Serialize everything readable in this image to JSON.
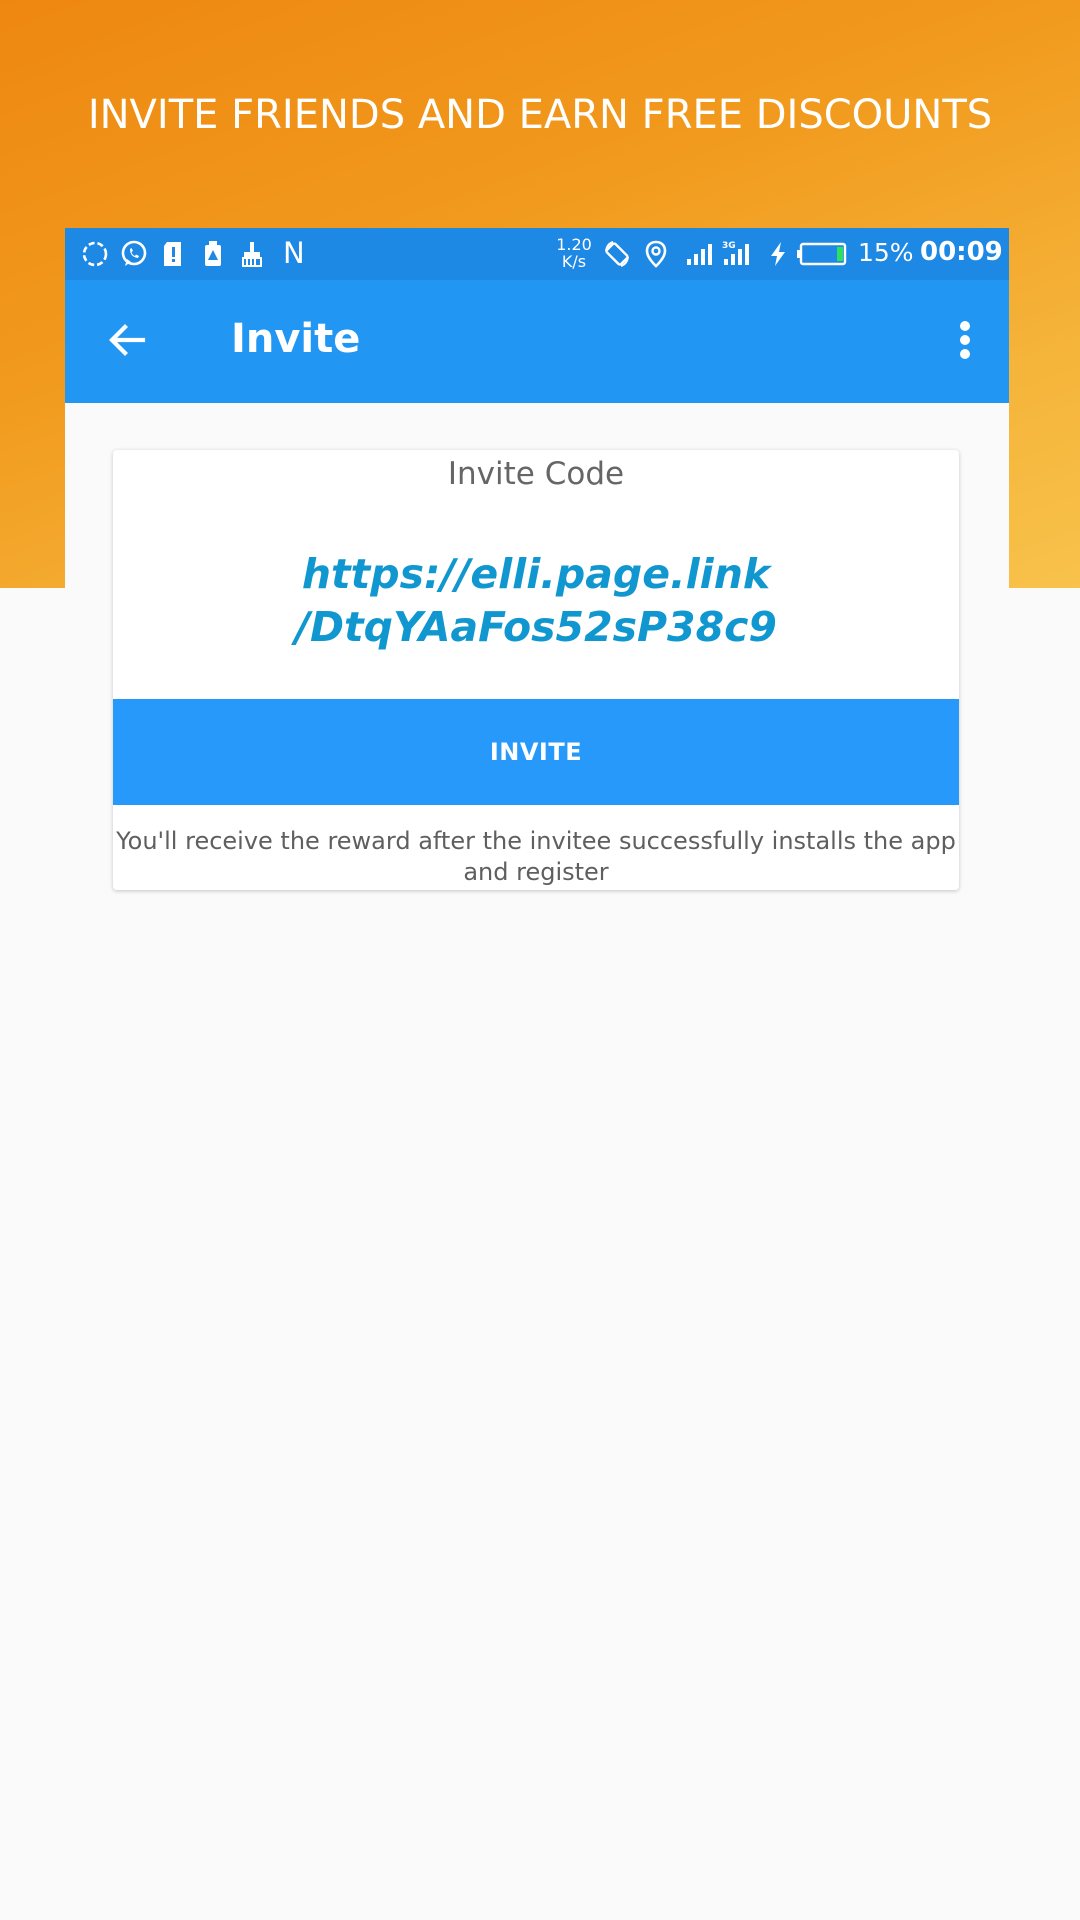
{
  "promo": {
    "headline": "INVITE FRIENDS AND EARN FREE DISCOUNTS"
  },
  "status_bar": {
    "left_icons": [
      "sync-icon",
      "whatsapp-icon",
      "sd-card-alert-icon",
      "storage-alert-icon",
      "cleaner-brush-icon",
      "n-notification-icon"
    ],
    "n_glyph": "N",
    "net_speed_value": "1.20",
    "net_speed_unit": "K/s",
    "right_icons": [
      "auto-rotate-icon",
      "location-icon",
      "signal-icon",
      "signal-3g-icon",
      "charging-icon",
      "battery-icon"
    ],
    "network_type": "3G",
    "battery_percent": "15%",
    "battery_level": 0.15,
    "time": "00:09"
  },
  "app_bar": {
    "title": "Invite",
    "back_icon": "arrow-back-icon",
    "menu_icon": "more-vertical-icon"
  },
  "card": {
    "label": "Invite Code",
    "link_line1": "https://elli.page.link",
    "link_line2": "/DtqYAaFos52sP38c9",
    "button_label": "INVITE",
    "note_line1": "You'll receive the reward after the invitee successfully installs the app",
    "note_line2": "and register"
  },
  "colors": {
    "promo_orange": "#ee8710",
    "promo_yellow": "#f8c24b",
    "status_bar": "#1e88e5",
    "app_bar": "#2196f3",
    "button": "#2699fb",
    "link": "#1197cf"
  }
}
